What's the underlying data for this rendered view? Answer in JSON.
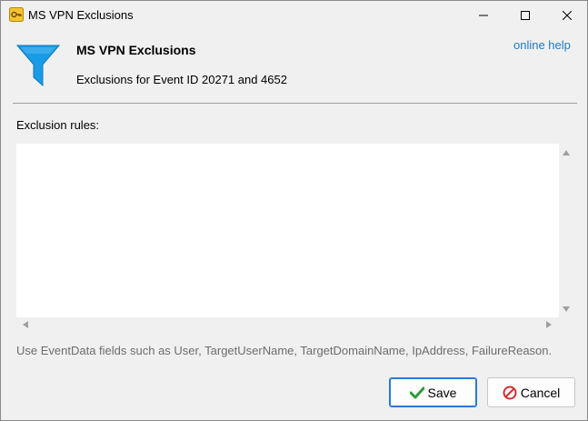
{
  "window": {
    "title": "MS VPN Exclusions",
    "icon": "app-key-icon",
    "controls": [
      "minimize-icon",
      "maximize-icon",
      "close-icon"
    ]
  },
  "header": {
    "icon": "funnel-filter-icon",
    "title": "MS VPN Exclusions",
    "subtitle": "Exclusions for Event ID 20271 and 4652",
    "help_link": "online help"
  },
  "rules": {
    "label": "Exclusion rules:",
    "value": ""
  },
  "hint": "Use EventData fields such as User, TargetUserName, TargetDomainName, IpAddress, FailureReason.",
  "buttons": {
    "save": "Save",
    "cancel": "Cancel"
  },
  "colors": {
    "accent": "#2a7ad6",
    "link": "#1f7ac3",
    "funnel": "#1a9be6"
  }
}
